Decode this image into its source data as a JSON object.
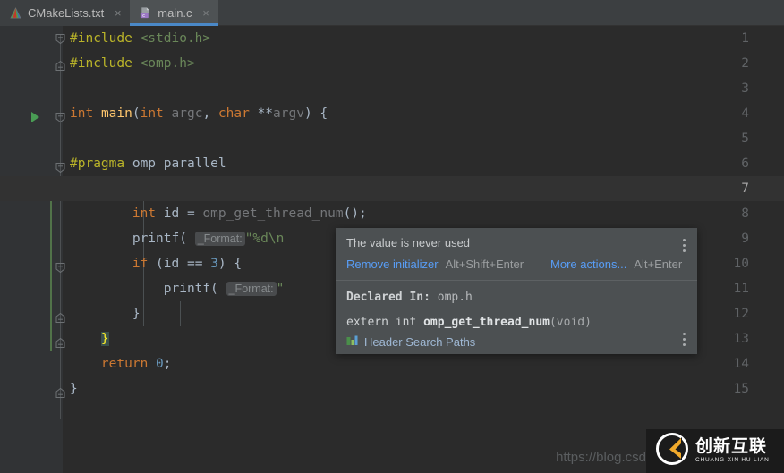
{
  "tabs": [
    {
      "label": "CMakeLists.txt",
      "icon": "cmake-icon",
      "active": false,
      "close": "×"
    },
    {
      "label": "main.c",
      "icon": "c-file-icon",
      "active": true,
      "close": "×"
    }
  ],
  "editor": {
    "filename": "main.c",
    "lines": [
      {
        "n": "1",
        "text": "#include <stdio.h>"
      },
      {
        "n": "2",
        "text": "#include <omp.h>"
      },
      {
        "n": "3",
        "text": ""
      },
      {
        "n": "4",
        "text": "int main(int argc, char **argv) {"
      },
      {
        "n": "5",
        "text": ""
      },
      {
        "n": "6",
        "text": "#pragma omp parallel"
      },
      {
        "n": "7",
        "text": "    {"
      },
      {
        "n": "8",
        "text": "        int id = omp_get_thread_num();"
      },
      {
        "n": "9",
        "text": "        printf( _Format: \"%d\\n\", id);"
      },
      {
        "n": "10",
        "text": "        if (id == 3) {"
      },
      {
        "n": "11",
        "text": "            printf( _Format: \"\" );"
      },
      {
        "n": "12",
        "text": "        }"
      },
      {
        "n": "13",
        "text": "    }"
      },
      {
        "n": "14",
        "text": "    return 0;"
      },
      {
        "n": "15",
        "text": "}"
      }
    ],
    "inlay_hint_label": "_Format:",
    "current_line": "7"
  },
  "popup": {
    "title": "The value is never used",
    "primary_action": "Remove initializer",
    "primary_shortcut": "Alt+Shift+Enter",
    "secondary_action": "More actions...",
    "secondary_shortcut": "Alt+Enter",
    "declared_in_label": "Declared In:",
    "declared_in_file": "omp.h",
    "signature_prefix": "extern int ",
    "signature_name": "omp_get_thread_num",
    "signature_suffix": "(void)",
    "header_search_paths": "Header Search Paths"
  },
  "watermark": {
    "url": "https://blog.csd",
    "logo_cn": "创新互联",
    "logo_pinyin": "CHUANG XIN HU LIAN"
  },
  "colors": {
    "editor_bg": "#2b2b2b",
    "gutter_bg": "#313335",
    "tabbar_bg": "#3c3f41",
    "tab_active_bg": "#4e5254",
    "tab_underline": "#4a88c7",
    "popup_bg": "#4c5052",
    "link": "#589df6",
    "keyword": "#cc7832",
    "function": "#ffc66d",
    "string": "#6a8759",
    "number": "#6897bb",
    "preprocessor": "#bbb529",
    "plain": "#a9b7c6",
    "run_arrow": "#499c54"
  }
}
